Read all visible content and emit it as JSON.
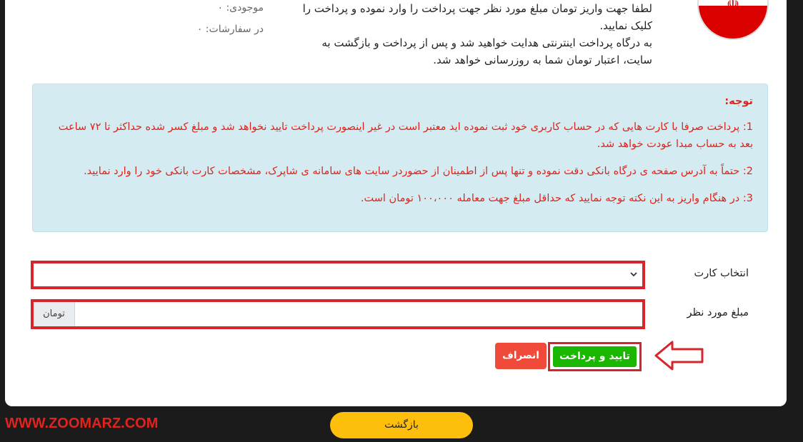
{
  "intro": {
    "line1": "لطفا جهت واریز تومان مبلغ مورد نظر جهت پرداخت را وارد نموده و پرداخت را کلیک نمایید.",
    "line2": "به درگاه پرداخت اینترنتی هدایت خواهید شد و پس از پرداخت و بازگشت به سایت، اعتبار تومان شما به روزرسانی خواهد شد."
  },
  "balances": {
    "stock_label": "موجودی: ۰",
    "orders_label": "در سفارشات: ۰"
  },
  "notice": {
    "title": "توجه:",
    "items": [
      "1: پرداخت صرفا با کارت هایی که در حساب کاربری خود ثبت نموده اید معتبر است در غیر اینصورت پرداخت تایید نخواهد شد و مبلغ کسر شده حداکثر تا ۷۲ ساعت بعد به حساب مبدا عودت خواهد شد.",
      "2: حتماً به آدرس صفحه ی درگاه بانکی دقت نموده و تنها پس از اطمینان از حضوردر سایت های سامانه ی شاپرک، مشخصات کارت بانکی خود را وارد نمایید.",
      "3: در هنگام واریز به این نکته توجه نمایید که حداقل مبلغ جهت معامله ۱۰۰،۰۰۰ تومان است."
    ]
  },
  "form": {
    "card_label": "انتخاب کارت",
    "card_value": "",
    "amount_label": "مبلغ مورد نظر",
    "amount_value": "",
    "currency_addon": "تومان"
  },
  "buttons": {
    "confirm": "تایید و پرداخت",
    "cancel": "انصراف",
    "back": "بازگشت"
  },
  "watermark": "WWW.ZOOMARZ.COM",
  "colors": {
    "highlight": "#d7262b",
    "confirm": "#1bb700",
    "cancel": "#ef4a3a",
    "back": "#fdbf0b",
    "notice_bg": "#d3ebf1"
  },
  "icons": {
    "flag": "iran-flag-icon",
    "arrow": "pointing-arrow-icon",
    "chevron": "chevron-down-icon"
  }
}
